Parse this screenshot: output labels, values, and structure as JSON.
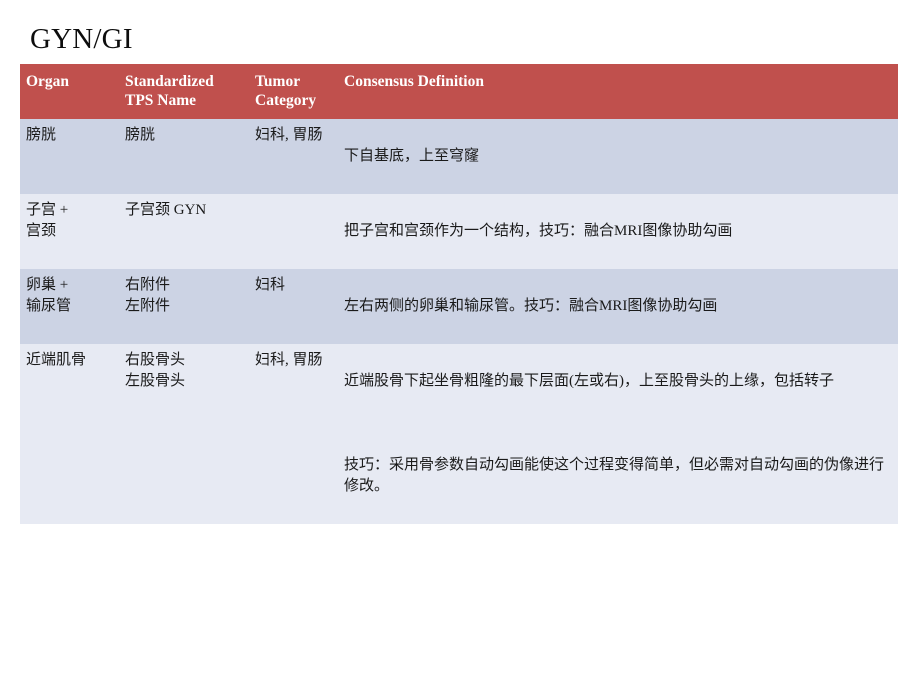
{
  "slide": {
    "title": "GYN/GI",
    "theme": {
      "header_bg": "#c0504d",
      "header_text": "#ffffff",
      "row_band_dark": "#ccd3e4",
      "row_band_light": "#e7eaf3",
      "body_text": "#1a1a1a",
      "page_bg": "#ffffff"
    }
  },
  "table": {
    "headers": [
      "Organ",
      "Standardized\nTPS Name",
      "Tumor\nCategory",
      "Consensus Definition"
    ],
    "rows": [
      {
        "organ": "膀胱",
        "tps_name": "膀胱",
        "tumor_category": "妇科, 胃肠",
        "definition_line1": "下自基底，上至穹窿",
        "definition_line2": ""
      },
      {
        "organ": "子宫 +\n宫颈",
        "tps_name": "子宫颈  GYN",
        "tumor_category": "",
        "definition_line1": "把子宫和宫颈作为一个结构，技巧：融合MRI图像协助勾画",
        "definition_line2": ""
      },
      {
        "organ": "卵巢 +\n输尿管",
        "tps_name": "右附件\n左附件",
        "tumor_category": "妇科",
        "definition_line1": "左右两侧的卵巢和输尿管。技巧：融合MRI图像协助勾画",
        "definition_line2": ""
      },
      {
        "organ": "近端肌骨",
        "tps_name": "右股骨头\n左股骨头",
        "tumor_category": "妇科, 胃肠",
        "definition_line1": "近端股骨下起坐骨粗隆的最下层面(左或右)，上至股骨头的上缘，包括转子",
        "definition_line2": "技巧：采用骨参数自动勾画能使这个过程变得简单，但必需对自动勾画的伪像进行修改。"
      }
    ]
  }
}
